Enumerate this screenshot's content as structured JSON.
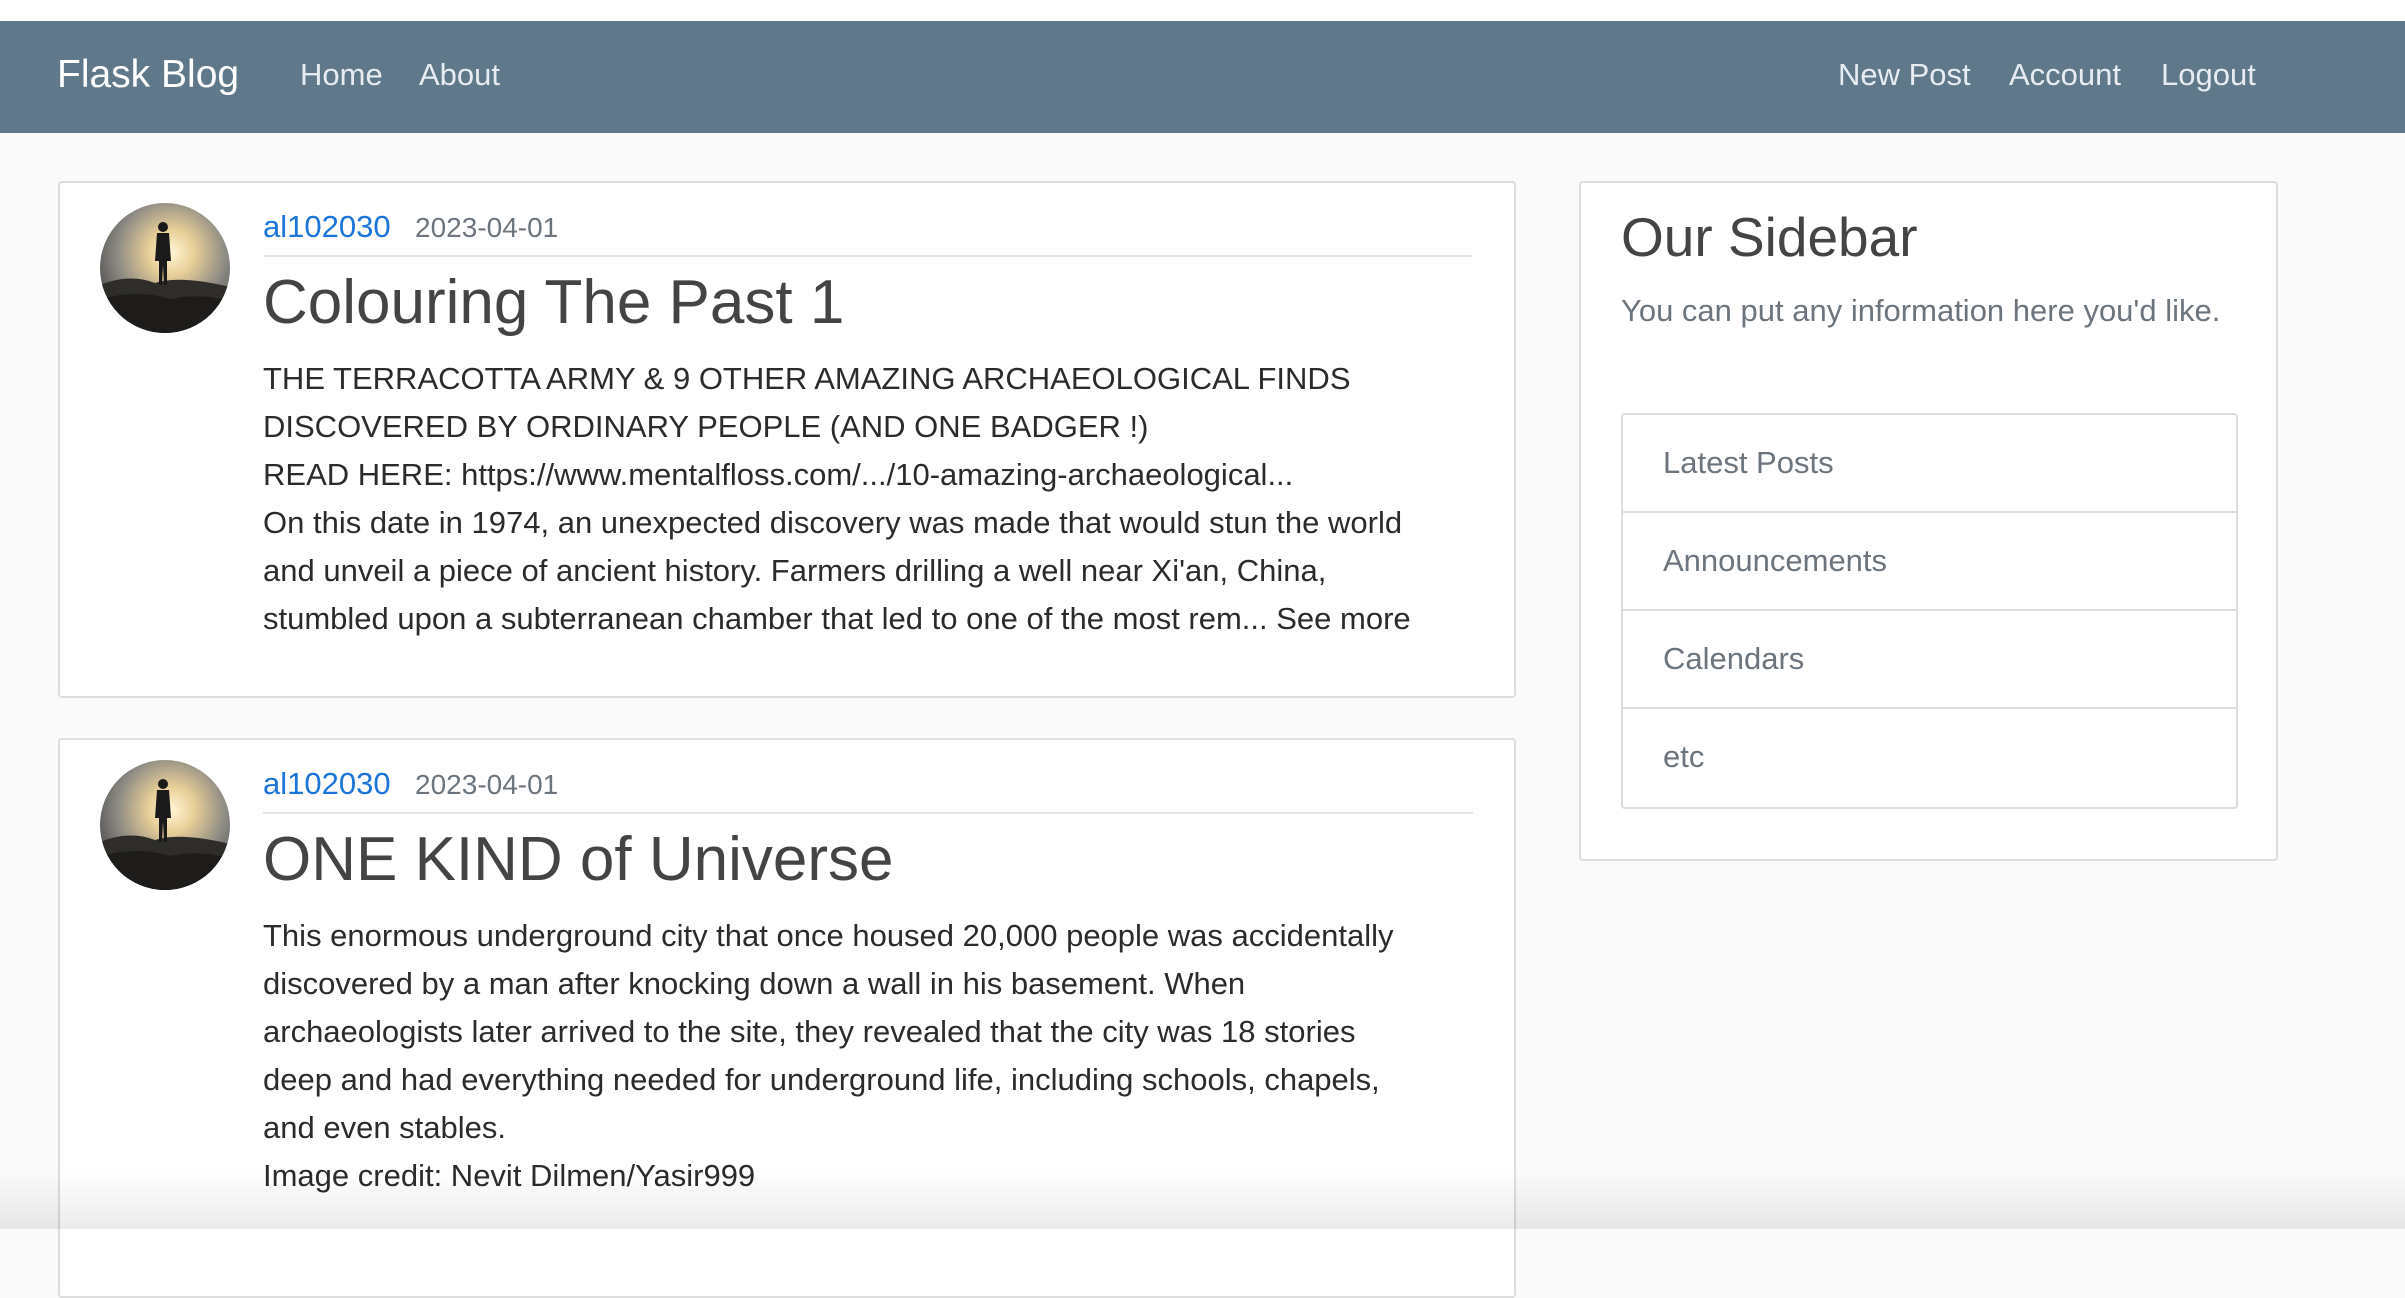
{
  "navbar": {
    "brand": "Flask Blog",
    "left_links": [
      "Home",
      "About"
    ],
    "right_links": [
      "New Post",
      "Account",
      "Logout"
    ],
    "background_color": "#5f788a"
  },
  "posts": [
    {
      "author": "al102030",
      "date": "2023-04-01",
      "title": "Colouring The Past 1",
      "content_lines": [
        "THE TERRACOTTA ARMY & 9 OTHER AMAZING ARCHAEOLOGICAL FINDS",
        "DISCOVERED BY ORDINARY PEOPLE (AND ONE BADGER !)",
        "READ HERE: https://www.mentalfloss.com/.../10-amazing-archaeological...",
        "On this date in 1974, an unexpected discovery was made that would stun the world",
        "and unveil a piece of ancient history. Farmers drilling a well near Xi'an, China,",
        "stumbled upon a subterranean chamber that led to one of the most rem... See more"
      ]
    },
    {
      "author": "al102030",
      "date": "2023-04-01",
      "title": "ONE KIND of Universe",
      "content_lines": [
        "This enormous underground city that once housed 20,000 people was accidentally",
        "discovered by a man after knocking down a wall in his basement. When",
        "archaeologists later arrived to the site, they revealed that the city was 18 stories",
        "deep and had everything needed for underground life, including schools, chapels,",
        "and even stables.",
        "Image credit: Nevit Dilmen/Yasir999"
      ]
    }
  ],
  "sidebar": {
    "title": "Our Sidebar",
    "text": "You can put any information here you'd like.",
    "items": [
      "Latest Posts",
      "Announcements",
      "Calendars",
      "etc"
    ]
  },
  "colors": {
    "author_link": "#1a74d9",
    "muted_text": "#6c757d"
  }
}
